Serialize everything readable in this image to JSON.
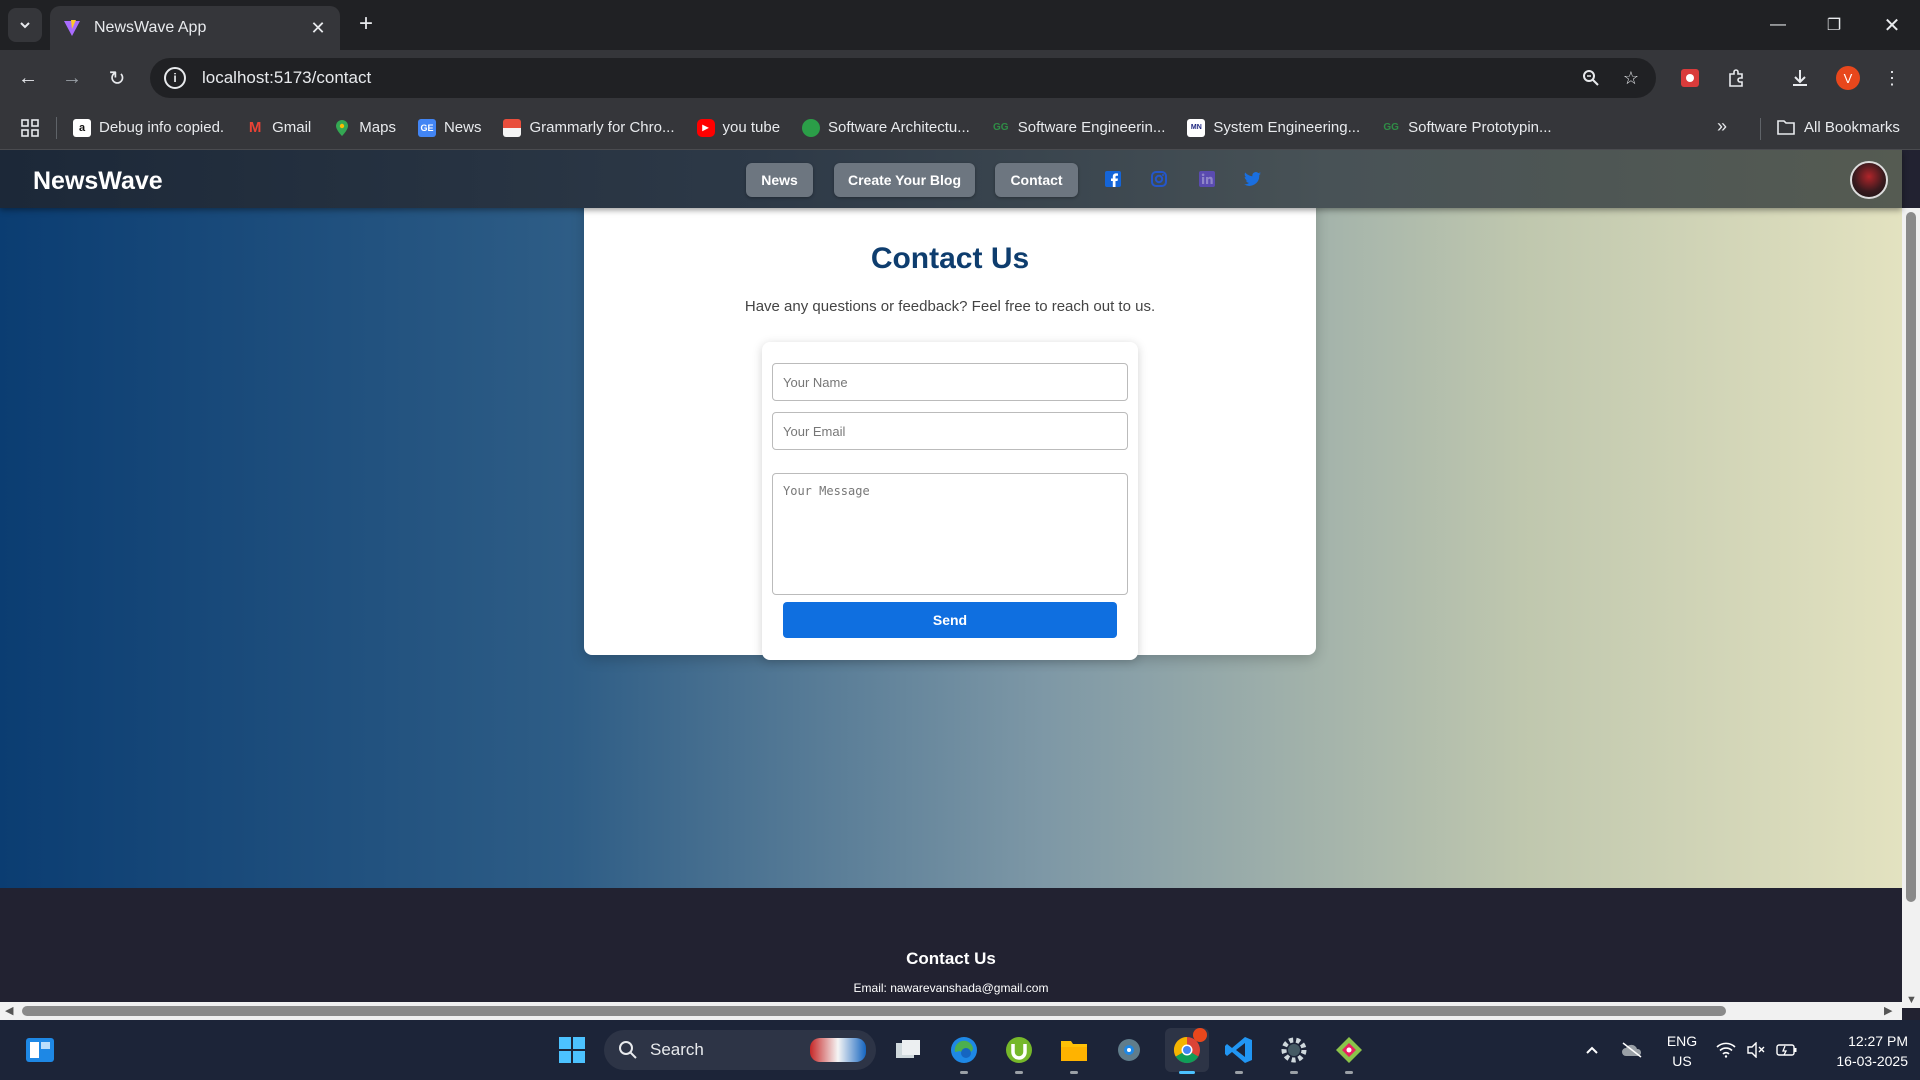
{
  "browser": {
    "tab_title": "NewsWave App",
    "new_tab": "+",
    "url": "localhost:5173/contact",
    "profile_initial": "V",
    "bookmarks": [
      {
        "label": "Debug info copied.",
        "icon": "amazon-icon"
      },
      {
        "label": "Gmail",
        "icon": "gmail-icon"
      },
      {
        "label": "Maps",
        "icon": "maps-icon"
      },
      {
        "label": "News",
        "icon": "google-news-icon"
      },
      {
        "label": "Grammarly for Chro...",
        "icon": "grammarly-icon"
      },
      {
        "label": "you tube",
        "icon": "youtube-icon"
      },
      {
        "label": "Software Architectu...",
        "icon": "green-leaf-icon"
      },
      {
        "label": "Software Engineerin...",
        "icon": "geeksforgeeks-icon"
      },
      {
        "label": "System Engineering...",
        "icon": "site-icon"
      },
      {
        "label": "Software Prototypin...",
        "icon": "geeksforgeeks-icon"
      }
    ],
    "all_bookmarks": "All Bookmarks"
  },
  "site": {
    "logo": "NewsWave",
    "nav": [
      {
        "label": "News"
      },
      {
        "label": "Create Your Blog"
      },
      {
        "label": "Contact"
      }
    ],
    "social_colors": {
      "facebook": "#1565d8",
      "instagram": "#2456c9",
      "linkedin": "#5a4bb0",
      "twitter": "#1a6fe0"
    }
  },
  "contact": {
    "title": "Contact Us",
    "subtitle": "Have any questions or feedback? Feel free to reach out to us.",
    "name_placeholder": "Your Name",
    "email_placeholder": "Your Email",
    "message_placeholder": "Your Message",
    "send_label": "Send"
  },
  "footer": {
    "title": "Contact Us",
    "email": "Email: nawarevanshada@gmail.com"
  },
  "taskbar": {
    "search_label": "Search",
    "lang_top": "ENG",
    "lang_bottom": "US",
    "time": "12:27 PM",
    "date": "16-03-2025"
  },
  "colors": {
    "accent": "#0f6fe0",
    "title": "#0e3d6e"
  }
}
